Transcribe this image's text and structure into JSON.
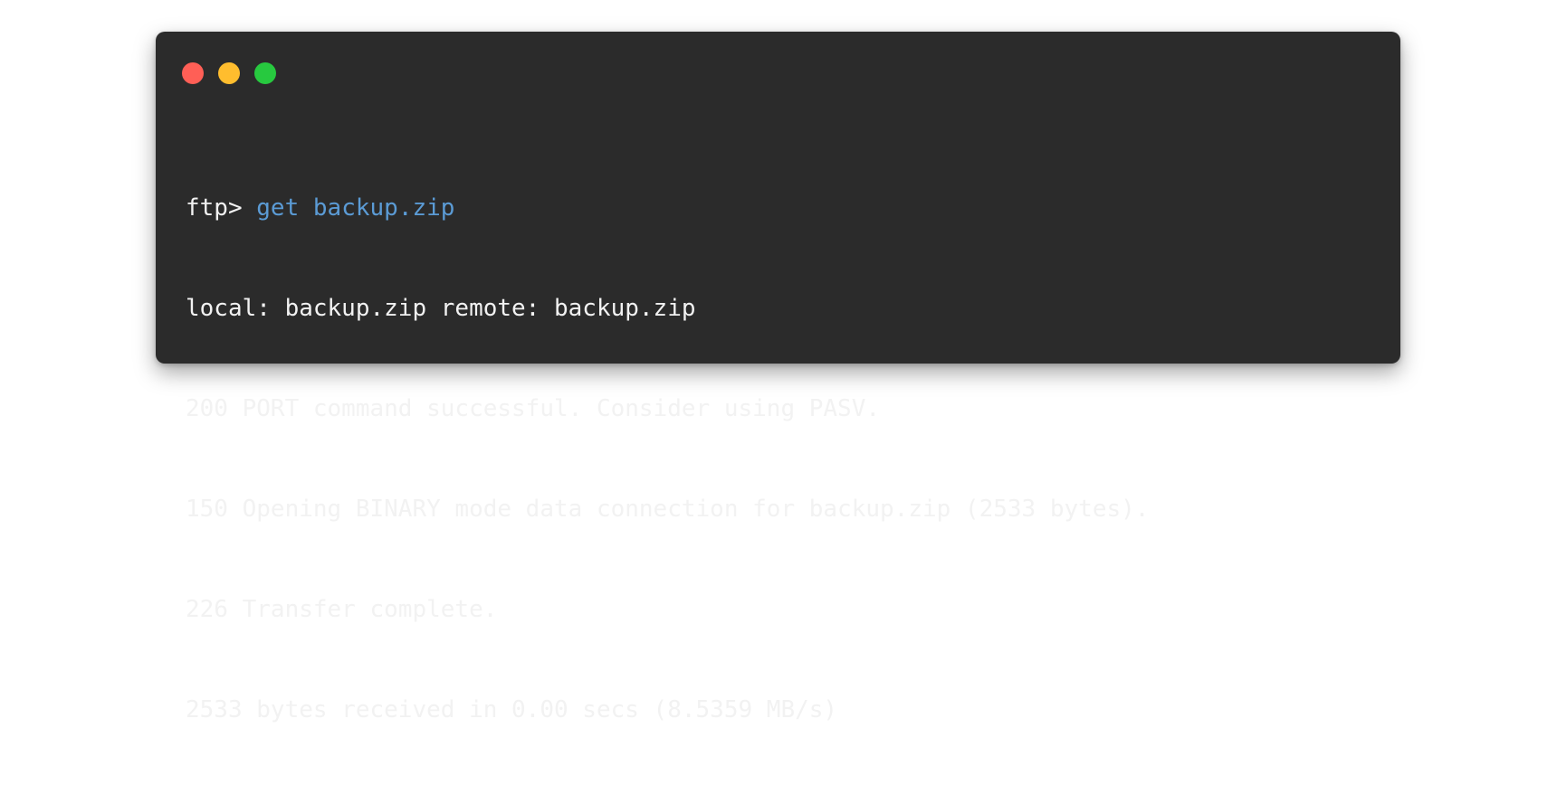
{
  "window": {
    "buttons": [
      {
        "name": "close",
        "color": "#ff5f56"
      },
      {
        "name": "minimize",
        "color": "#ffbd2e"
      },
      {
        "name": "maximize",
        "color": "#27c93f"
      }
    ]
  },
  "terminal": {
    "prompt": "ftp> ",
    "command": "get backup.zip",
    "command_color": "#5b9bd5",
    "output": [
      "local: backup.zip remote: backup.zip",
      "200 PORT command successful. Consider using PASV.",
      "150 Opening BINARY mode data connection for backup.zip (2533 bytes).",
      "226 Transfer complete.",
      "2533 bytes received in 0.00 secs (8.5359 MB/s)"
    ]
  }
}
